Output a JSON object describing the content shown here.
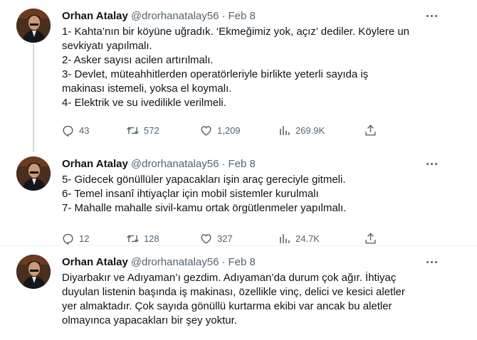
{
  "tweets": [
    {
      "author": "Orhan Atalay",
      "handle": "@drorhanatalay56",
      "separator": "·",
      "date": "Feb 8",
      "lines": [
        "1- Kahta’nın bir köyüne uğradık. ‘Ekmeğimiz yok, açız’ dediler. Köylere un",
        "sevkiyatı yapılmalı.",
        "2- Asker sayısı acilen artırılmalı.",
        "3- Devlet, müteahhitlerden operatörleriyle birlikte yeterli sayıda iş",
        "makinası istemeli, yoksa el koymalı.",
        "4- Elektrik ve su ivedilikle verilmeli."
      ],
      "stats": {
        "replies": "43",
        "retweets": "572",
        "likes": "1,209",
        "views": "269.9K"
      }
    },
    {
      "author": "Orhan Atalay",
      "handle": "@drorhanatalay56",
      "separator": "·",
      "date": "Feb 8",
      "lines": [
        "5- Gidecek gönüllüler yapacakları işin araç gereciyle gitmeli.",
        "6- Temel insanî ihtiyaçlar için mobil sistemler kurulmalı",
        "7- Mahalle mahalle sivil-kamu ortak örgütlenmeler yapılmalı."
      ],
      "stats": {
        "replies": "12",
        "retweets": "128",
        "likes": "327",
        "views": "24.7K"
      }
    },
    {
      "author": "Orhan Atalay",
      "handle": "@drorhanatalay56",
      "separator": "·",
      "date": "Feb 8",
      "lines": [
        "Diyarbakır ve Adıyaman’ı gezdim. Adıyaman’da durum çok ağır. İhtiyaç",
        "duyulan listenin başında iş makinası, özellikle vinç, delici ve kesici aletler",
        "yer almaktadır. Çok sayıda gönüllü kurtarma ekibi var ancak bu aletler",
        "olmayınca yapacakları bir şey yoktur."
      ]
    }
  ],
  "icons": {
    "reply": "reply-icon",
    "retweet": "retweet-icon",
    "like": "like-icon",
    "views": "views-icon",
    "share": "share-icon",
    "more": "more-icon"
  },
  "colors": {
    "text": "#0f1419",
    "secondary": "#536471",
    "divider": "#eff3f4",
    "thread_line": "#cfd9de"
  }
}
